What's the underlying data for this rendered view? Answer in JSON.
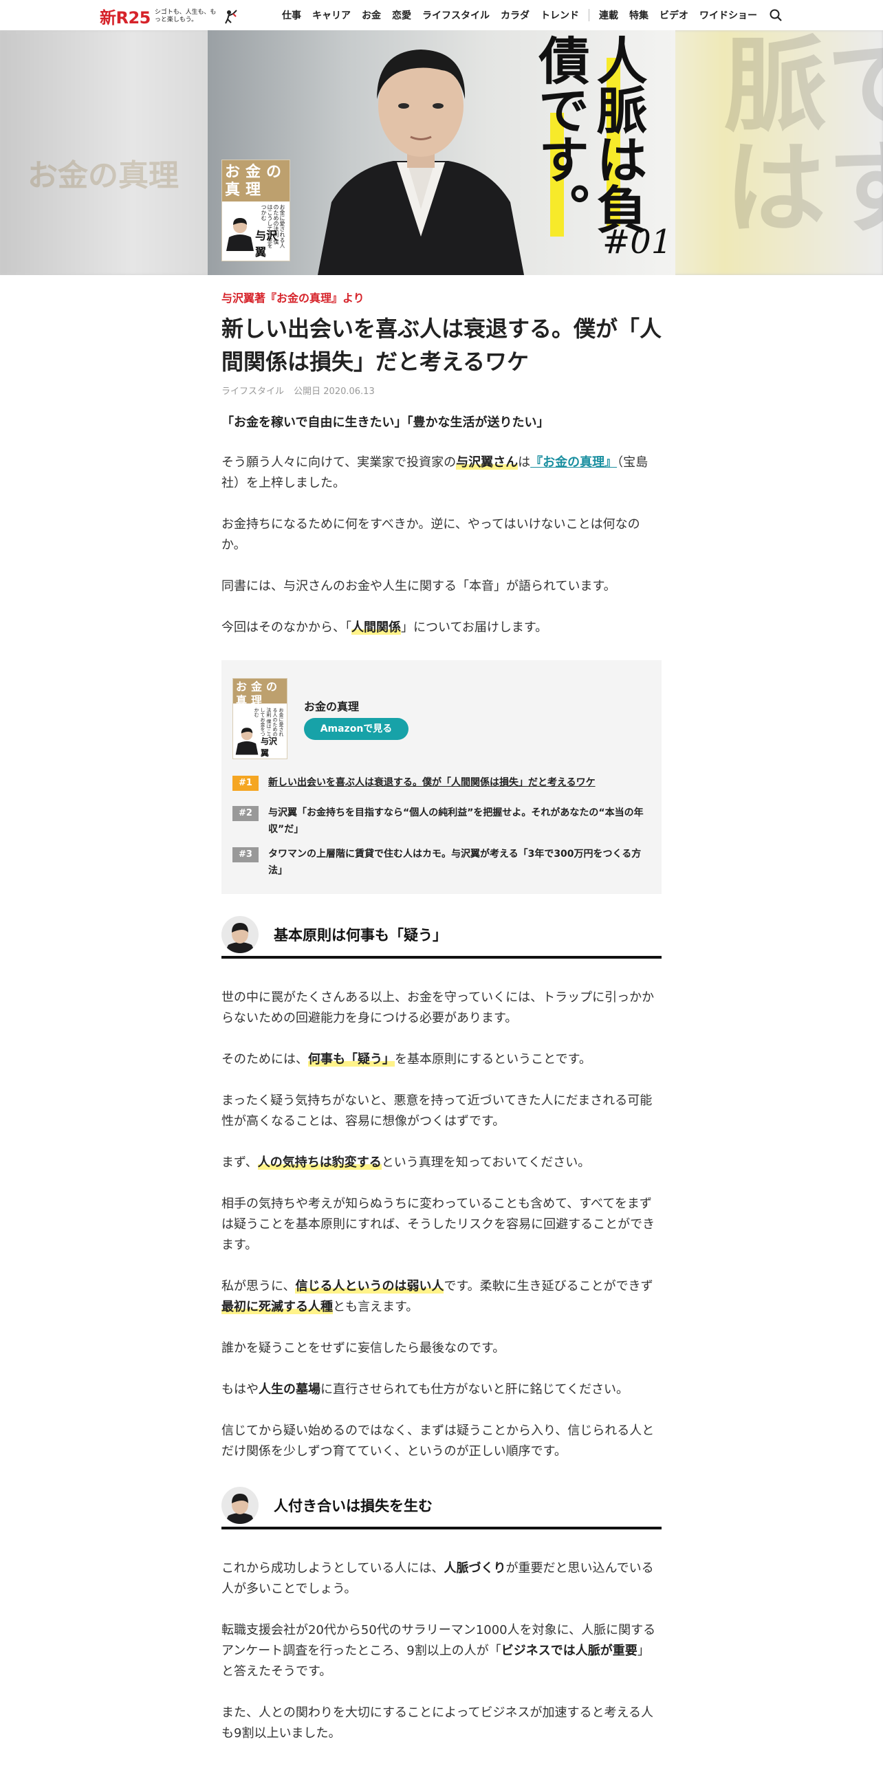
{
  "header": {
    "logo_main": "新R25",
    "logo_sub": "シゴトも、人生も、もっと楽しもう。",
    "nav_primary": [
      "仕事",
      "キャリア",
      "お金",
      "恋愛",
      "ライフスタイル",
      "カラダ",
      "トレンド"
    ],
    "nav_secondary": [
      "連載",
      "特集",
      "ビデオ",
      "ワイドショー"
    ],
    "search_icon": "search-icon"
  },
  "hero": {
    "title": "人脈は負債です。",
    "number": "#01",
    "book_title": "お金の真理",
    "book_cover_text": "お金に愛される人のための法則 僕はこうしてお金をつかむ",
    "book_author_mark": "与沢 翼",
    "ghost_left": "お金の真理",
    "ghost_right": "負債です脈は",
    "accent": "#f7ea2a"
  },
  "article": {
    "kicker": "与沢翼著『お金の真理』より",
    "title": "新しい出会いを喜ぶ人は衰退する。僕が「人間関係は損失」だと考えるワケ",
    "category": "ライフスタイル",
    "published": "公開日 2020.06.13",
    "lead": "「お金を稼いで自由に生きたい」「豊かな生活が送りたい」",
    "p1": {
      "a": "そう願う人々に向けて、実業家で投資家の",
      "b": "与沢翼さん",
      "c": "は",
      "link": "『お金の真理』",
      "d": "（宝島社）を上梓しました。"
    },
    "p2": "お金持ちになるために何をすべきか。逆に、やってはいけないことは何なのか。",
    "p3": "同書には、与沢さんのお金や人生に関する「本音」が語られています。",
    "p4": {
      "a": "今回はそのなかから、「",
      "b": "人間関係",
      "c": "」についてお届けします。"
    }
  },
  "series_box": {
    "book_title": "お金の真理",
    "button_label": "Amazonで見る",
    "episodes": [
      {
        "badge": "#1",
        "text": "新しい出会いを喜ぶ人は衰退する。僕が「人間関係は損失」だと考えるワケ",
        "color": "#f5a623"
      },
      {
        "badge": "#2",
        "text": "与沢翼「お金持ちを目指すなら“個人の純利益”を把握せよ。それがあなたの“本当の年収”だ」",
        "color": "#999999"
      },
      {
        "badge": "#3",
        "text": "タワマンの上層階に賃貸で住む人はカモ。与沢翼が考える「3年で300万円をつくる方法」",
        "color": "#999999"
      }
    ]
  },
  "section1": {
    "heading": "基本原則は何事も「疑う」",
    "p1": "世の中に罠がたくさんある以上、お金を守っていくには、トラップに引っかからないための回避能力を身につける必要があります。",
    "p2": {
      "a": "そのためには、",
      "b": "何事も「疑う」",
      "c": "を基本原則にするということです。"
    },
    "p3": "まったく疑う気持ちがないと、悪意を持って近づいてきた人にだまされる可能性が高くなることは、容易に想像がつくはずです。",
    "p4": {
      "a": "まず、",
      "b": "人の気持ちは豹変する",
      "c": "という真理を知っておいてください。"
    },
    "p5": "相手の気持ちや考えが知らぬうちに変わっていることも含めて、すべてをまずは疑うことを基本原則にすれば、そうしたリスクを容易に回避することができます。",
    "p6": {
      "a": "私が思うに、",
      "b": "信じる人というのは弱い人",
      "c": "です。柔軟に生き延びることができず",
      "d": "最初に死滅する人種",
      "e": "とも言えます。"
    },
    "p7": "誰かを疑うことをせずに妄信したら最後なのです。",
    "p8": {
      "a": "もはや",
      "b": "人生の墓場",
      "c": "に直行させられても仕方がないと肝に銘じてください。"
    },
    "p9": "信じてから疑い始めるのではなく、まずは疑うことから入り、信じられる人とだけ関係を少しずつ育てていく、というのが正しい順序です。"
  },
  "section2": {
    "heading": "人付き合いは損失を生む",
    "p1": {
      "a": "これから成功しようとしている人には、",
      "b": "人脈づくり",
      "c": "が重要だと思い込んでいる人が多いことでしょう。"
    },
    "p2": {
      "a": "転職支援会社が20代から50代のサラリーマン1000人を対象に、人脈に関するアンケート調査を行ったところ、9割以上の人が「",
      "b": "ビジネスでは人脈が重要",
      "c": "」と答えたそうです。"
    },
    "p3": "また、人との関わりを大切にすることによってビジネスが加速すると考える人も9割以上いました。"
  }
}
